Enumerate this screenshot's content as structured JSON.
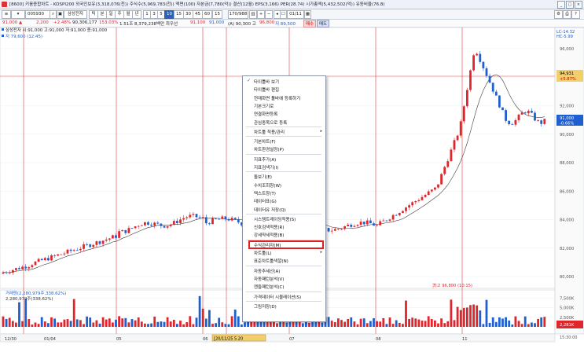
{
  "window": {
    "title": "[8600] 키움종합차트 - KOSPI200 외국인보유(3,318,076(천)) 주식수(5,969,783(천)) 액면(100) 자본금(7,780(억)) 결산(12월) EPS(3,166) PER(28.74) 시가총액(5,432,502(억)) 유동비율(76.8)",
    "buttons": [
      "_",
      "□",
      "×"
    ]
  },
  "toolbar": {
    "code": "005930",
    "stock_name": "삼성전자",
    "period_buttons": [
      "틱",
      "분",
      "일",
      "주",
      "월",
      "년"
    ],
    "number_buttons": [
      "1",
      "3",
      "5",
      "10",
      "15",
      "30",
      "45",
      "60"
    ],
    "active_number": "10",
    "count": "15",
    "bars": "170/988",
    "date": "01/11"
  },
  "infobar": {
    "price": "91,000 ▲",
    "change": "2,200",
    "change_pct": "+2.48%",
    "volume": "90,306,177",
    "ratio": "153.03%",
    "amount": "1.51조 8,379,238백만 최우선",
    "ask": "91,100",
    "bid": "91,000",
    "ab_label": "(A) 90,300 고",
    "high": "96,800",
    "low_label": "저 89,500",
    "buy_label": "매수",
    "sell_label": "매도"
  },
  "legend": {
    "ohlc": "삼성전자 시:91,000 고:91,000 저:91,000 종:91,000",
    "low_note": "저 79,600 (12:45)"
  },
  "annotations": {
    "min_label": "최고 96,800 (10:15)",
    "volume_legend": "거래량(2,280,979주,338.62%)",
    "volume_value": "2,280,979주(338.62%)",
    "crosshair_x": "[20/11/25 5.20"
  },
  "price_axis": {
    "ticks": [
      "96,000",
      "94,000",
      "92,000",
      "90,000",
      "88,000",
      "86,000",
      "84,000",
      "82,000",
      "80,000"
    ],
    "top_labels": [
      "LC-14.32",
      "HC-5.99"
    ],
    "cross_price": "94,931",
    "cross_pct": "+5.87%",
    "current_price": "91,000",
    "current_pct": "-0.66%"
  },
  "volume_axis": {
    "ticks": [
      "7,500K",
      "5,000K",
      "2,500K"
    ],
    "current": "2,281K",
    "unit": "15:30:00"
  },
  "date_axis": {
    "labels": [
      "12/30",
      "01/04",
      "05",
      "06",
      "07",
      "08",
      "11"
    ]
  },
  "context_menu": {
    "items": [
      {
        "label": "타이틀바 보기",
        "checked": true
      },
      {
        "label": "타이틀바 편집"
      },
      {
        "label": "현재화면 툴바에 등록하기"
      },
      {
        "label": "기본크기로"
      },
      {
        "label": "연결화면등록"
      },
      {
        "label": "관심종목으로 등록"
      },
      {
        "label": "차트툴 적용/관리",
        "submenu": true
      },
      {
        "label": "기본차트(F)"
      },
      {
        "label": "차트환경설정(P)"
      },
      {
        "label": "지표추가(A)"
      },
      {
        "label": "지표검색기(I)"
      },
      {
        "label": "돌보기(E)"
      },
      {
        "label": "수치조회창(W)"
      },
      {
        "label": "텍스트창(T)"
      },
      {
        "label": "데이터표(G)"
      },
      {
        "label": "데이터유 저장(Q)"
      },
      {
        "label": "시스템트레이딩적용(S)"
      },
      {
        "label": "신호검색적용(R)"
      },
      {
        "label": "강세약세적용(B)"
      },
      {
        "label": "수식관리자(M)",
        "highlighted": true
      },
      {
        "label": "차트툴(L)",
        "submenu": true
      },
      {
        "label": "표준차트툴색깔(N)"
      },
      {
        "label": "자동추세선(A)"
      },
      {
        "label": "자동패턴분석(V)"
      },
      {
        "label": "캔들패턴분석(C)"
      },
      {
        "label": "가격데이터 시뮬레이션(S)"
      },
      {
        "label": "그림저장(D)"
      }
    ]
  },
  "colors": {
    "up": "#e0262d",
    "down": "#1f5fd0",
    "vline": "#e23a3a",
    "ma": "#3a3a3a",
    "accent": "#2b62b8"
  },
  "chart_data": {
    "type": "candlestick",
    "price_ylim": [
      79000,
      97000
    ],
    "volume_ylim": [
      0,
      9000000
    ]
  }
}
